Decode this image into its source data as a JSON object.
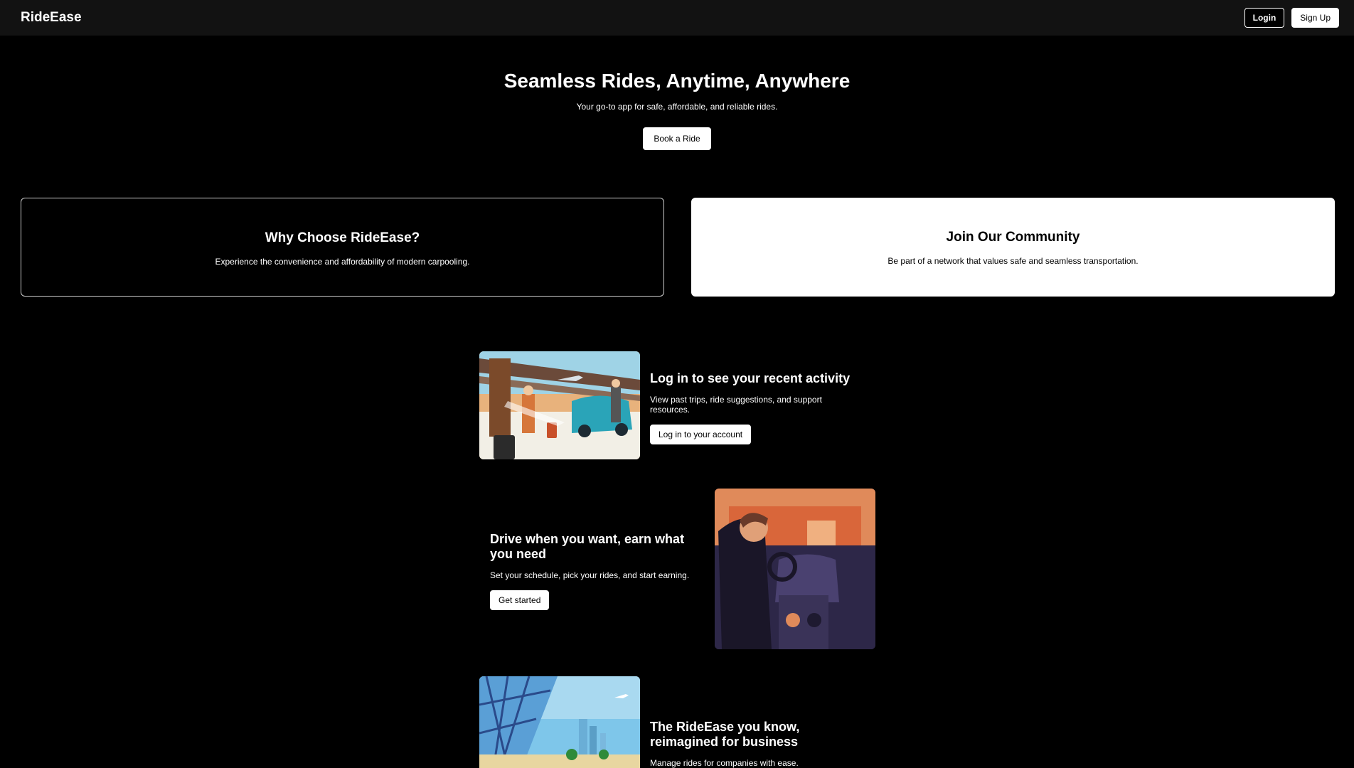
{
  "nav": {
    "brand": "RideEase",
    "login": "Login",
    "signup": "Sign Up"
  },
  "hero": {
    "title": "Seamless Rides, Anytime, Anywhere",
    "subtitle": "Your go-to app for safe, affordable, and reliable rides.",
    "cta": "Book a Ride"
  },
  "cards": [
    {
      "title": "Why Choose RideEase?",
      "text": "Experience the convenience and affordability of modern carpooling."
    },
    {
      "title": "Join Our Community",
      "text": "Be part of a network that values safe and seamless transportation."
    }
  ],
  "features": [
    {
      "title": "Log in to see your recent activity",
      "text": "View past trips, ride suggestions, and support resources.",
      "button": "Log in to your account",
      "image_icon": "airport-illustration"
    },
    {
      "title": "Drive when you want, earn what you need",
      "text": "Set your schedule, pick your rides, and start earning.",
      "button": "Get started",
      "image_icon": "driver-illustration"
    },
    {
      "title": "The RideEase you know, reimagined for business",
      "text": "Manage rides for companies with ease.",
      "image_icon": "business-illustration"
    }
  ]
}
